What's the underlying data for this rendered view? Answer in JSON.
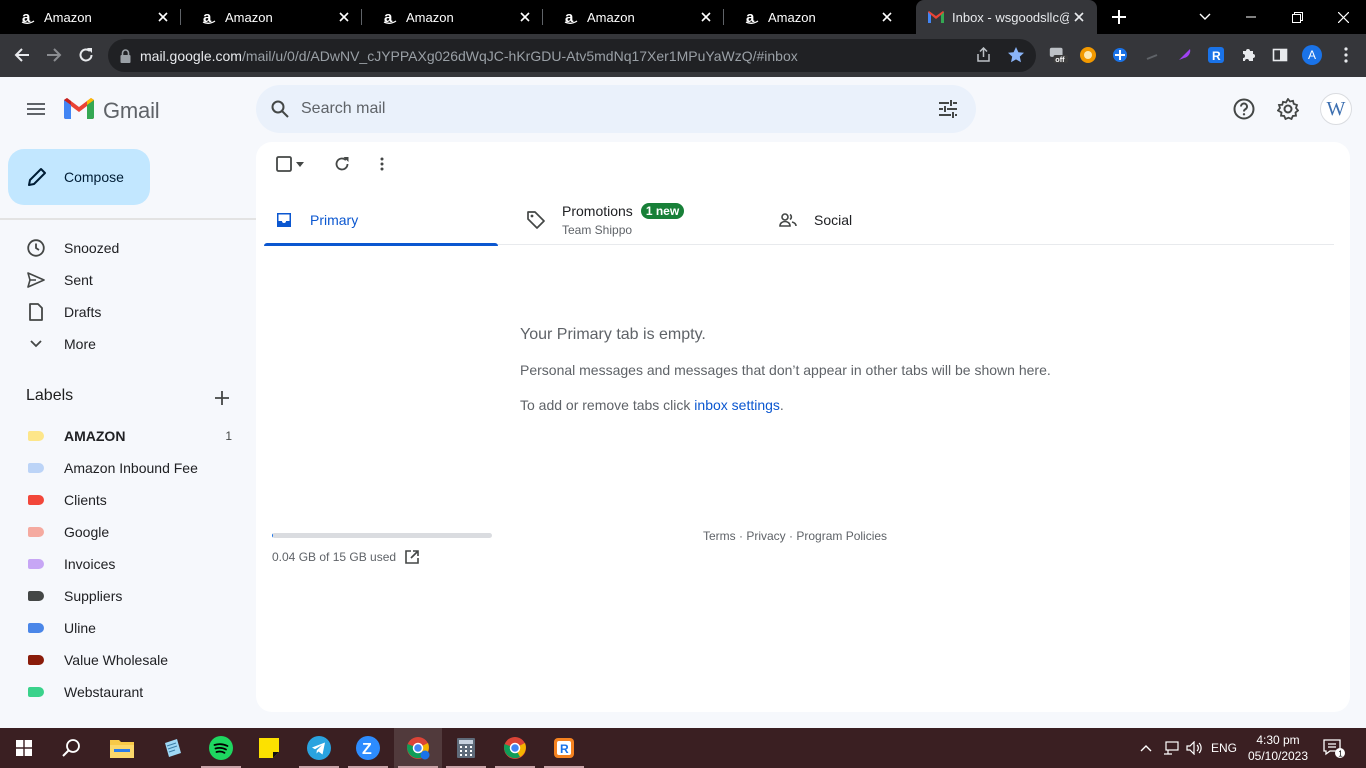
{
  "browser": {
    "tabs": [
      {
        "title": "Amazon"
      },
      {
        "title": "Amazon"
      },
      {
        "title": "Amazon"
      },
      {
        "title": "Amazon"
      },
      {
        "title": "Amazon"
      },
      {
        "title": "Inbox - wsgoodsllc@"
      }
    ],
    "url_host": "mail.google.com",
    "url_path": "/mail/u/0/d/ADwNV_cJYPPAXg026dWqJC-hKrGDU-Atv5mdNq17Xer1MPuYaWzQ/#inbox",
    "profile_initial": "A",
    "ext_badge": "off"
  },
  "gmail": {
    "app_name": "Gmail",
    "search_placeholder": "Search mail",
    "avatar_initial": "W",
    "compose_label": "Compose",
    "nav": [
      {
        "label": "Snoozed",
        "icon": "clock-icon"
      },
      {
        "label": "Sent",
        "icon": "send-icon"
      },
      {
        "label": "Drafts",
        "icon": "draft-icon"
      },
      {
        "label": "More",
        "icon": "chevron-down-icon"
      }
    ],
    "labels_heading": "Labels",
    "labels": [
      {
        "name": "AMAZON",
        "count": "1",
        "color": "#fde68a",
        "bold": true
      },
      {
        "name": "Amazon Inbound Fee",
        "count": "",
        "color": "#bcd4f7"
      },
      {
        "name": "Clients",
        "count": "",
        "color": "#f2473a"
      },
      {
        "name": "Google",
        "count": "",
        "color": "#f5aaa0"
      },
      {
        "name": "Invoices",
        "count": "",
        "color": "#c7a6f5"
      },
      {
        "name": "Suppliers",
        "count": "",
        "color": "#444746"
      },
      {
        "name": "Uline",
        "count": "",
        "color": "#4a86e8"
      },
      {
        "name": "Value Wholesale",
        "count": "",
        "color": "#8a1c0a"
      },
      {
        "name": "Webstaurant",
        "count": "",
        "color": "#3ad28b"
      }
    ],
    "inbox_tabs": {
      "primary": "Primary",
      "promotions": "Promotions",
      "promotions_badge": "1 new",
      "promotions_sender": "Team Shippo",
      "social": "Social"
    },
    "empty_state": {
      "title": "Your Primary tab is empty.",
      "line1": "Personal messages and messages that don’t appear in other tabs will be shown here.",
      "line2_prefix": "To add or remove tabs click ",
      "line2_link": "inbox settings",
      "line2_suffix": "."
    },
    "storage": {
      "text": "0.04 GB of 15 GB used",
      "fraction": 0.003
    },
    "footer": {
      "terms": "Terms",
      "privacy": "Privacy",
      "program_policies": "Program Policies",
      "separator": " · "
    }
  },
  "taskbar": {
    "language": "ENG",
    "time": "4:30 pm",
    "date": "05/10/2023",
    "notification_count": "1"
  },
  "colors": {
    "gmail_bg": "#f6f8fc",
    "compose_bg": "#c2e7ff",
    "accent_blue": "#0b57d0",
    "badge_green": "#188038",
    "taskbar_bg": "#3a1f22"
  }
}
